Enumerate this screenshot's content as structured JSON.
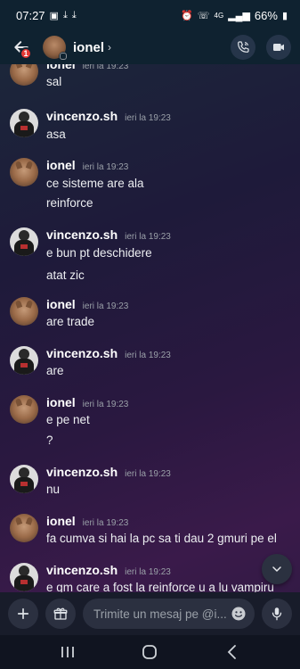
{
  "status": {
    "time": "07:27",
    "battery": "66%",
    "network": "4G"
  },
  "header": {
    "name": "ionel",
    "badge": "1"
  },
  "messages": [
    {
      "user": "ionel",
      "avatar": "cougar",
      "time": "ieri la 19:23",
      "lines": [
        "sal"
      ]
    },
    {
      "user": "vincenzo.sh",
      "avatar": "vince",
      "time": "ieri la 19:23",
      "lines": [
        "asa"
      ]
    },
    {
      "user": "ionel",
      "avatar": "cougar",
      "time": "ieri la 19:23",
      "lines": [
        "ce sisteme are ala",
        "reinforce"
      ]
    },
    {
      "user": "vincenzo.sh",
      "avatar": "vince",
      "time": "ieri la 19:23",
      "lines": [
        "e bun pt deschidere",
        "atat zic"
      ]
    },
    {
      "user": "ionel",
      "avatar": "cougar",
      "time": "ieri la 19:23",
      "lines": [
        "are trade"
      ]
    },
    {
      "user": "vincenzo.sh",
      "avatar": "vince",
      "time": "ieri la 19:23",
      "lines": [
        "are"
      ]
    },
    {
      "user": "ionel",
      "avatar": "cougar",
      "time": "ieri la 19:23",
      "lines": [
        "e pe net",
        "?"
      ]
    },
    {
      "user": "vincenzo.sh",
      "avatar": "vince",
      "time": "ieri la 19:23",
      "lines": [
        "nu"
      ]
    },
    {
      "user": "ionel",
      "avatar": "cougar",
      "time": "ieri la 19:23",
      "lines": [
        "fa cumva si hai la pc sa ti dau 2 gmuri pe el"
      ]
    },
    {
      "user": "vincenzo.sh",
      "avatar": "vince",
      "time": "ieri la 19:23",
      "lines": [
        "e gm care a fost la reinforce u a lu vampiru"
      ]
    }
  ],
  "composer": {
    "placeholder": "Trimite un mesaj pe @i..."
  },
  "icons": {
    "back": "arrow-left-icon",
    "call": "phone-icon",
    "video": "video-camera-icon",
    "add": "plus-icon",
    "gift": "gift-icon",
    "emoji": "emoji-icon",
    "mic": "microphone-icon",
    "scroll": "chevron-down-icon"
  }
}
